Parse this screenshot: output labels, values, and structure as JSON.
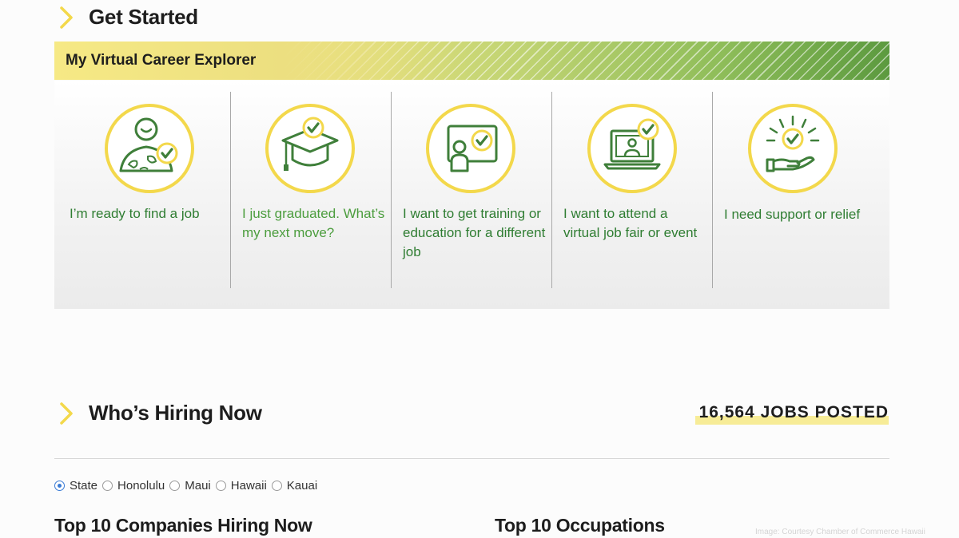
{
  "get_started": {
    "title": "Get Started"
  },
  "explorer": {
    "title": "My Virtual Career Explorer",
    "cards": [
      {
        "label": "I’m ready to find a job"
      },
      {
        "label": "I just graduated. What’s my next move?"
      },
      {
        "label": "I want to get training or education for a different job"
      },
      {
        "label": "I want to attend a virtual job fair or event"
      },
      {
        "label": "I need support or relief"
      }
    ]
  },
  "hiring": {
    "title": "Who’s Hiring Now",
    "jobs_posted": "16,564 JOBS POSTED",
    "regions": [
      {
        "label": "State",
        "selected": true
      },
      {
        "label": "Honolulu",
        "selected": false
      },
      {
        "label": "Maui",
        "selected": false
      },
      {
        "label": "Hawaii",
        "selected": false
      },
      {
        "label": "Kauai",
        "selected": false
      }
    ],
    "top_companies_title": "Top 10 Companies Hiring Now",
    "top_occupations_title": "Top 10 Occupations"
  },
  "image_credit": "Image: Courtesy Chamber of Commerce Hawaii",
  "colors": {
    "accent_yellow": "#f3d84b",
    "brand_green": "#2f7d32",
    "radio_blue": "#3a7bd5"
  }
}
